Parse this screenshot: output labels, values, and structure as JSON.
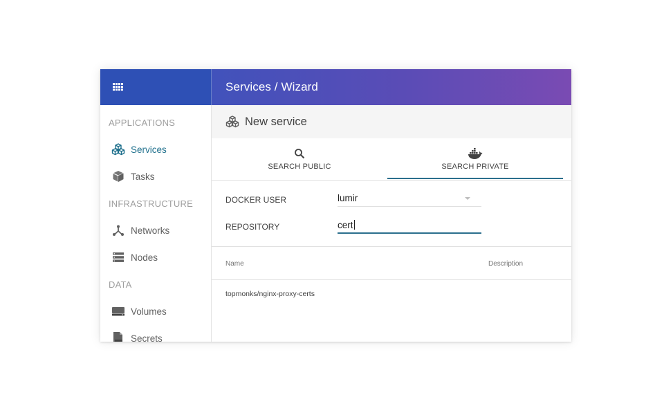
{
  "topbar": {
    "menu_icon": "apps-grid-icon",
    "title": "Services / Wizard"
  },
  "sidebar": {
    "sections": [
      {
        "heading": "APPLICATIONS",
        "items": [
          {
            "label": "Services",
            "icon": "cubes-icon",
            "active": true
          },
          {
            "label": "Tasks",
            "icon": "box-icon",
            "active": false
          }
        ]
      },
      {
        "heading": "INFRASTRUCTURE",
        "items": [
          {
            "label": "Networks",
            "icon": "network-icon",
            "active": false
          },
          {
            "label": "Nodes",
            "icon": "server-list-icon",
            "active": false
          }
        ]
      },
      {
        "heading": "DATA",
        "items": [
          {
            "label": "Volumes",
            "icon": "drive-icon",
            "active": false
          },
          {
            "label": "Secrets",
            "icon": "key-file-icon",
            "active": false
          }
        ]
      }
    ]
  },
  "main": {
    "title": "New service",
    "title_icon": "cubes-icon",
    "tabs": [
      {
        "label": "SEARCH PUBLIC",
        "icon": "search-icon",
        "active": false
      },
      {
        "label": "SEARCH PRIVATE",
        "icon": "docker-whale-icon",
        "active": true
      }
    ],
    "form": {
      "docker_user_label": "DOCKER USER",
      "docker_user_value": "lumir",
      "repository_label": "REPOSITORY",
      "repository_value": "cert"
    },
    "table": {
      "columns": [
        "Name",
        "Description"
      ],
      "rows": [
        {
          "name": "topmonks/nginx-proxy-certs",
          "description": ""
        }
      ]
    }
  },
  "colors": {
    "topbar_left": "#2e50b5",
    "topbar_gradient_start": "#4152bb",
    "topbar_gradient_end": "#7a4bb3",
    "accent": "#2b6f8d",
    "active_nav": "#1e6f8c"
  }
}
